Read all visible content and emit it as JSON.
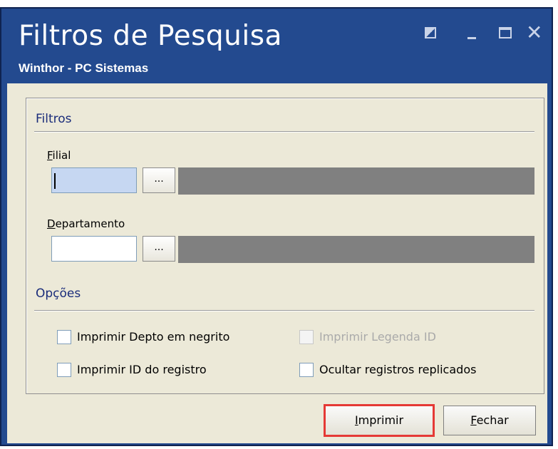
{
  "window": {
    "title": "Filtros de Pesquisa",
    "subtitle": "Winthor - PC Sistemas",
    "controls": [
      "restore",
      "minimize",
      "maximize",
      "close"
    ],
    "close_glyph": "✕"
  },
  "filtros": {
    "section_title": "Filtros",
    "filial": {
      "label_first": "F",
      "label_rest": "ilial",
      "value": "",
      "dots": "..."
    },
    "departamento": {
      "label_first": "D",
      "label_rest": "epartamento",
      "value": "",
      "dots": "..."
    }
  },
  "opcoes": {
    "section_title": "Opções",
    "checkboxes": [
      {
        "label": "Imprimir Depto em negrito",
        "checked": false,
        "enabled": true
      },
      {
        "label": "Imprimir Legenda ID",
        "checked": false,
        "enabled": false
      },
      {
        "label": "Imprimir ID do registro",
        "checked": false,
        "enabled": true
      },
      {
        "label": "Ocultar registros replicados",
        "checked": false,
        "enabled": true
      }
    ]
  },
  "buttons": {
    "imprimir": {
      "first": "I",
      "rest": "mprimir"
    },
    "fechar": {
      "first": "F",
      "rest": "echar"
    }
  },
  "colors": {
    "title_bar": "#234a8f",
    "client_bg": "#ece9d8",
    "highlight": "#e53935",
    "section_text": "#1a2c7a"
  }
}
